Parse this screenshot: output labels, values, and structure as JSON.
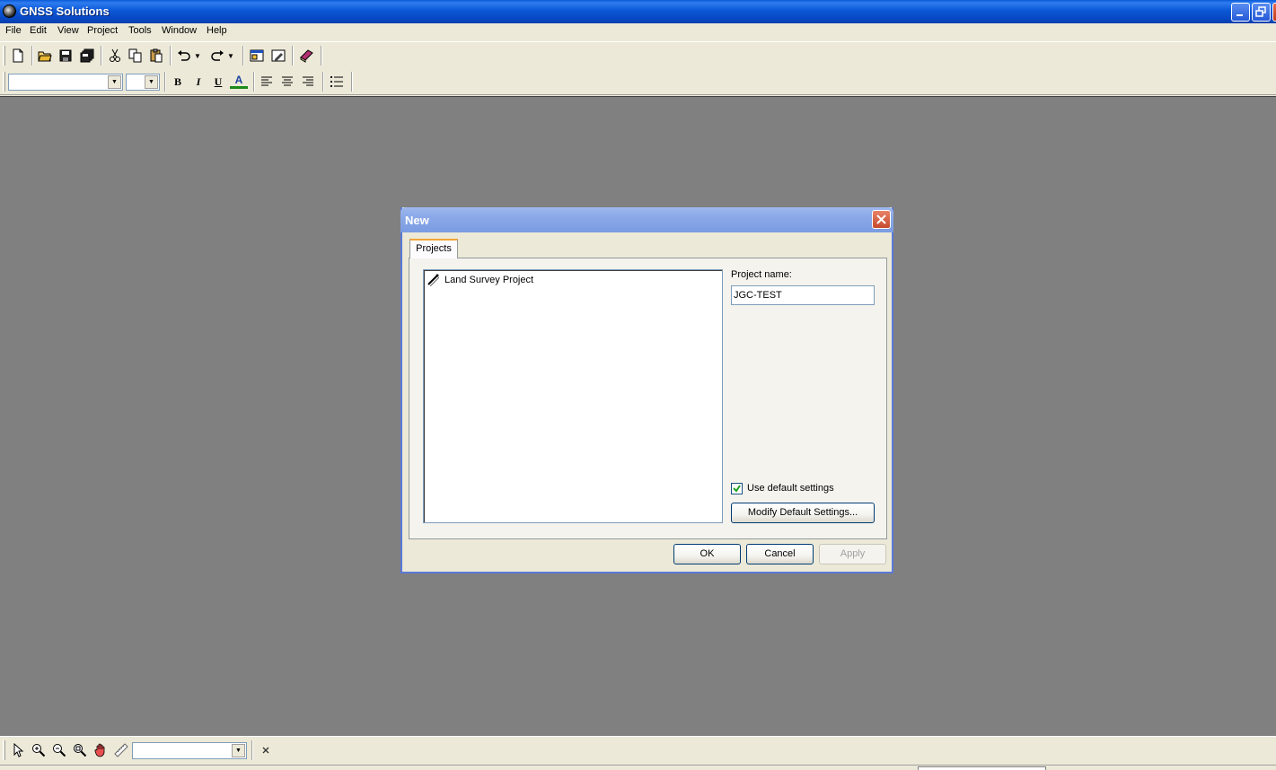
{
  "window": {
    "title": "GNSS Solutions"
  },
  "menu": [
    "File",
    "Edit",
    "View",
    "Project",
    "Tools",
    "Window",
    "Help"
  ],
  "dialog": {
    "title": "New",
    "tab_label": "Projects",
    "list_items": [
      "Land Survey Project"
    ],
    "project_name_label": "Project name:",
    "project_name_value": "JGC-TEST",
    "use_default_label": "Use default settings",
    "use_default_checked": true,
    "modify_button": "Modify Default Settings...",
    "ok_button": "OK",
    "cancel_button": "Cancel",
    "apply_button": "Apply"
  },
  "format_toolbar": {
    "bold": "B",
    "italic": "I",
    "underline": "U",
    "font_color": "A"
  },
  "colors": {
    "titlebar": "#0b58d6",
    "workspace": "#808080",
    "dialog_title": "#8aa8e8",
    "chrome": "#ece9d8"
  }
}
